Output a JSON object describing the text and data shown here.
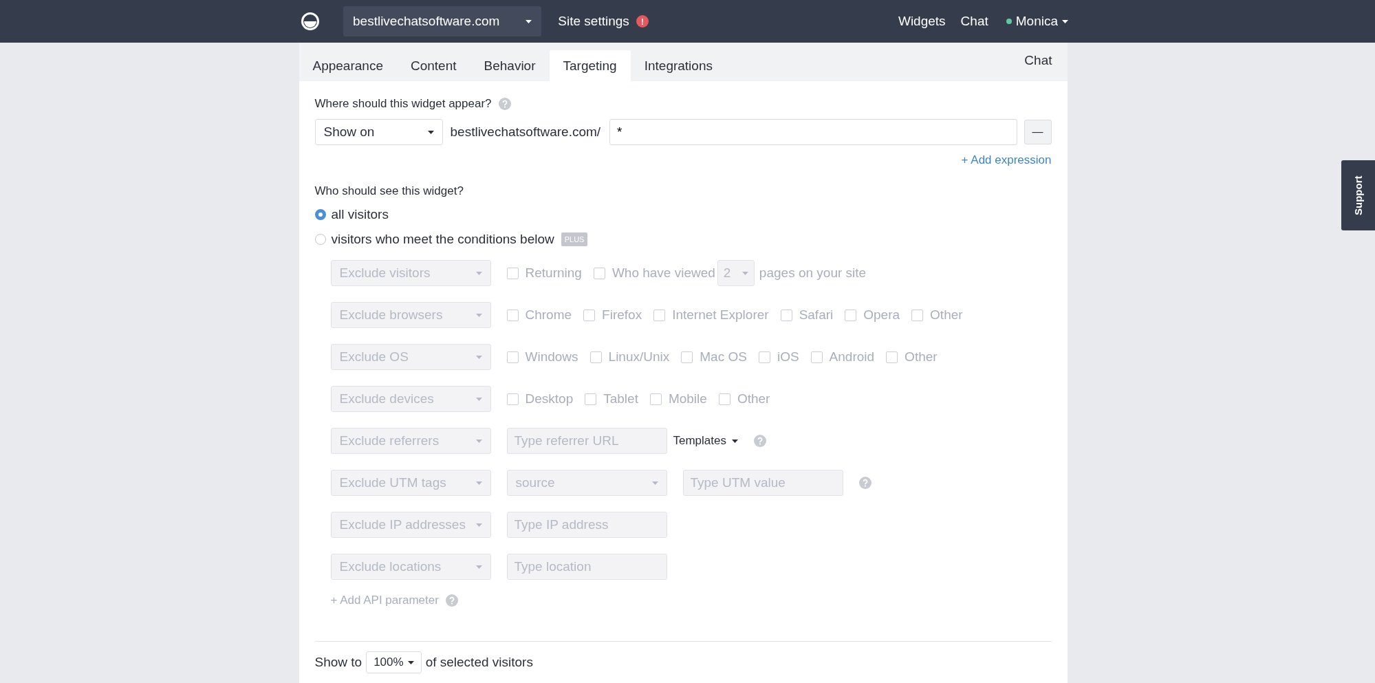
{
  "topbar": {
    "site": "bestlivechatsoftware.com",
    "site_settings": "Site settings",
    "alert": "!",
    "nav": [
      {
        "label": "Widgets"
      },
      {
        "label": "Chat"
      }
    ],
    "user": {
      "name": "Monica",
      "online": true
    }
  },
  "tabs": [
    {
      "label": "Appearance",
      "selected": false
    },
    {
      "label": "Content",
      "selected": false
    },
    {
      "label": "Behavior",
      "selected": false
    },
    {
      "label": "Targeting",
      "selected": true
    },
    {
      "label": "Integrations",
      "selected": false
    }
  ],
  "tabs_right": "Chat",
  "where": {
    "label": "Where should this widget appear?",
    "mode": "Show on",
    "domain": "bestlivechatsoftware.com/",
    "value": "*",
    "remove": "—",
    "add": "+ Add expression"
  },
  "who": {
    "label": "Who should see this widget?",
    "options": [
      {
        "label": "all visitors",
        "selected": true
      },
      {
        "label": "visitors who meet the conditions below",
        "selected": false,
        "badge": "PLUS"
      }
    ]
  },
  "conditions": {
    "disabled": true,
    "rows": [
      {
        "select": "Exclude visitors",
        "controls": [
          {
            "kind": "checkbox",
            "label": "Returning",
            "checked": false
          },
          {
            "kind": "checkbox",
            "label": "Who have viewed",
            "checked": false
          },
          {
            "kind": "dropdown",
            "value": "2"
          },
          {
            "kind": "text",
            "label": "pages on your site"
          }
        ]
      },
      {
        "select": "Exclude browsers",
        "controls": [
          {
            "kind": "checkbox",
            "label": "Chrome",
            "checked": false
          },
          {
            "kind": "checkbox",
            "label": "Firefox",
            "checked": false
          },
          {
            "kind": "checkbox",
            "label": "Internet Explorer",
            "checked": false
          },
          {
            "kind": "checkbox",
            "label": "Safari",
            "checked": false
          },
          {
            "kind": "checkbox",
            "label": "Opera",
            "checked": false
          },
          {
            "kind": "checkbox",
            "label": "Other",
            "checked": false
          }
        ]
      },
      {
        "select": "Exclude OS",
        "controls": [
          {
            "kind": "checkbox",
            "label": "Windows",
            "checked": false
          },
          {
            "kind": "checkbox",
            "label": "Linux/Unix",
            "checked": false
          },
          {
            "kind": "checkbox",
            "label": "Mac OS",
            "checked": false
          },
          {
            "kind": "checkbox",
            "label": "iOS",
            "checked": false
          },
          {
            "kind": "checkbox",
            "label": "Android",
            "checked": false
          },
          {
            "kind": "checkbox",
            "label": "Other",
            "checked": false
          }
        ]
      },
      {
        "select": "Exclude devices",
        "controls": [
          {
            "kind": "checkbox",
            "label": "Desktop",
            "checked": false
          },
          {
            "kind": "checkbox",
            "label": "Tablet",
            "checked": false
          },
          {
            "kind": "checkbox",
            "label": "Mobile",
            "checked": false
          },
          {
            "kind": "checkbox",
            "label": "Other",
            "checked": false
          }
        ]
      },
      {
        "select": "Exclude referrers",
        "controls": [
          {
            "kind": "input",
            "placeholder": "Type referrer URL"
          },
          {
            "kind": "menu",
            "label": "Templates"
          },
          {
            "kind": "help"
          }
        ]
      },
      {
        "select": "Exclude UTM tags",
        "controls": [
          {
            "kind": "select",
            "value": "source"
          },
          {
            "kind": "input",
            "placeholder": "Type UTM value"
          },
          {
            "kind": "help"
          }
        ]
      },
      {
        "select": "Exclude IP addresses",
        "controls": [
          {
            "kind": "input",
            "placeholder": "Type IP address"
          }
        ]
      },
      {
        "select": "Exclude locations",
        "controls": [
          {
            "kind": "input",
            "placeholder": "Type location"
          }
        ]
      }
    ],
    "add": "+ Add API parameter"
  },
  "show_to": {
    "prefix": "Show to",
    "value": "100%",
    "suffix": "of selected visitors"
  },
  "support": "Support"
}
